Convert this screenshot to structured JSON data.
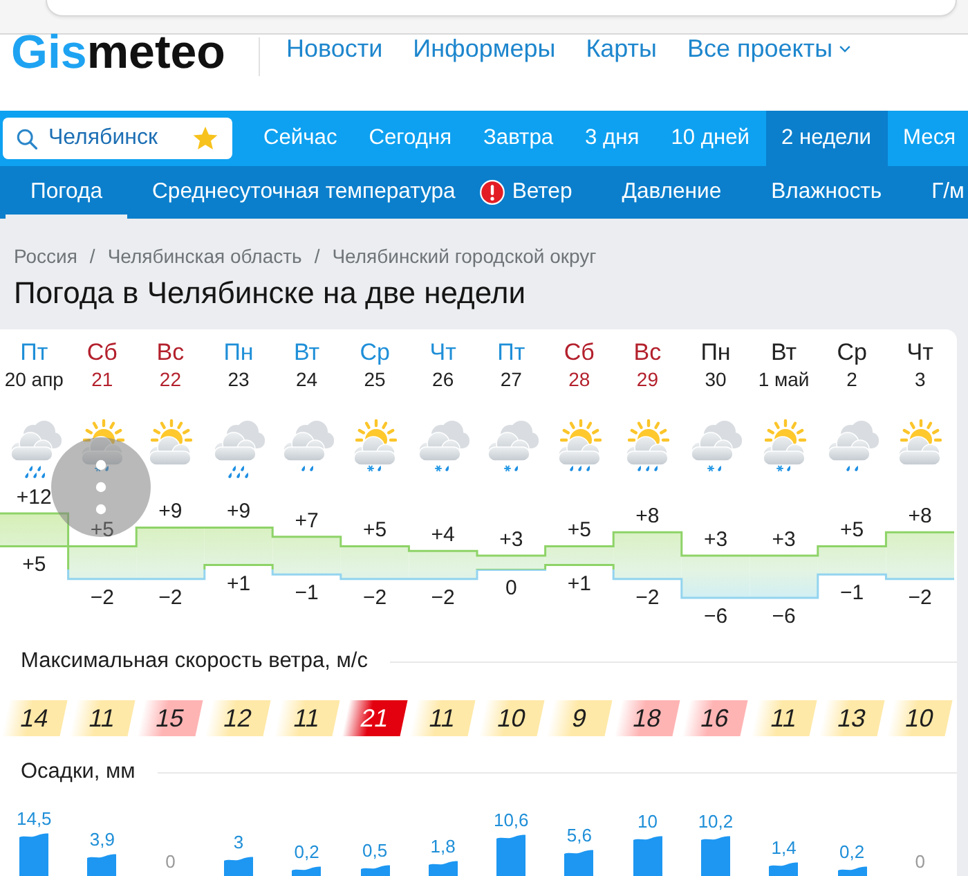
{
  "header": {
    "logo": {
      "accent": "Gis",
      "rest": "meteo"
    },
    "links": [
      {
        "label": "Новости",
        "dropdown": false
      },
      {
        "label": "Информеры",
        "dropdown": false
      },
      {
        "label": "Карты",
        "dropdown": false
      },
      {
        "label": "Все проекты",
        "dropdown": true
      }
    ]
  },
  "search": {
    "value": "Челябинск"
  },
  "periods": [
    {
      "label": "Сейчас",
      "selected": false
    },
    {
      "label": "Сегодня",
      "selected": false
    },
    {
      "label": "Завтра",
      "selected": false
    },
    {
      "label": "3 дня",
      "selected": false
    },
    {
      "label": "10 дней",
      "selected": false
    },
    {
      "label": "2 недели",
      "selected": true
    },
    {
      "label": "Меся",
      "selected": false
    }
  ],
  "sections": [
    {
      "label": "Погода",
      "selected": true,
      "alert": false
    },
    {
      "label": "Среднесуточная температура",
      "selected": false,
      "alert": false
    },
    {
      "label": "Ветер",
      "selected": false,
      "alert": true
    },
    {
      "label": "Давление",
      "selected": false,
      "alert": false
    },
    {
      "label": "Влажность",
      "selected": false,
      "alert": false
    },
    {
      "label": "Г/м",
      "selected": false,
      "alert": false
    }
  ],
  "breadcrumbs": [
    {
      "label": "Россия"
    },
    {
      "separator": "/",
      "label": "Челябинская область"
    },
    {
      "separator": "/",
      "label": "Челябинский городской округ"
    }
  ],
  "title": "Погода в Челябинске на две недели",
  "forecast": {
    "days": [
      {
        "name": "Пт",
        "date": "20 апр",
        "color": "#1f8fd8",
        "weekend": false,
        "kind": "heavyrain",
        "max": "+12",
        "min": "+5",
        "wind": {
          "speed": "14",
          "color": "#ffe9a8"
        },
        "precip": "14,5"
      },
      {
        "name": "Сб",
        "date": "21",
        "color": "#b3202c",
        "weekend": true,
        "kind": "partlysleet",
        "max": "+5",
        "min": "−2",
        "wind": {
          "speed": "11",
          "color": "#ffe9a8"
        },
        "precip": "3,9"
      },
      {
        "name": "Вс",
        "date": "22",
        "color": "#b3202c",
        "weekend": true,
        "kind": "partly",
        "max": "+9",
        "min": "−2",
        "wind": {
          "speed": "15",
          "color": "#ffb4b4"
        },
        "precip": "0"
      },
      {
        "name": "Пн",
        "date": "23",
        "color": "#1f8fd8",
        "weekend": false,
        "kind": "heavyrain",
        "max": "+9",
        "min": "+1",
        "wind": {
          "speed": "12",
          "color": "#ffe9a8"
        },
        "precip": "3"
      },
      {
        "name": "Вт",
        "date": "24",
        "color": "#1f8fd8",
        "weekend": false,
        "kind": "rain",
        "max": "+7",
        "min": "−1",
        "wind": {
          "speed": "11",
          "color": "#ffe9a8"
        },
        "precip": "0,2"
      },
      {
        "name": "Ср",
        "date": "25",
        "color": "#1f8fd8",
        "weekend": false,
        "kind": "partlysleet",
        "max": "+5",
        "min": "−2",
        "wind": {
          "speed": "21",
          "color": "#e3000f"
        },
        "precip": "0,5"
      },
      {
        "name": "Чт",
        "date": "26",
        "color": "#1f8fd8",
        "weekend": false,
        "kind": "sleet",
        "max": "+4",
        "min": "−2",
        "wind": {
          "speed": "11",
          "color": "#ffe9a8"
        },
        "precip": "1,8"
      },
      {
        "name": "Пт",
        "date": "27",
        "color": "#1f8fd8",
        "weekend": false,
        "kind": "sleet",
        "max": "+3",
        "min": "0",
        "wind": {
          "speed": "10",
          "color": "#ffe9a8"
        },
        "precip": "10,6"
      },
      {
        "name": "Сб",
        "date": "28",
        "color": "#b3202c",
        "weekend": true,
        "kind": "partlyheavyrain",
        "max": "+5",
        "min": "+1",
        "wind": {
          "speed": "9",
          "color": "#ffe9a8"
        },
        "precip": "5,6"
      },
      {
        "name": "Вс",
        "date": "29",
        "color": "#b3202c",
        "weekend": true,
        "kind": "partlyheavyrain",
        "max": "+8",
        "min": "−2",
        "wind": {
          "speed": "18",
          "color": "#ffb4b4"
        },
        "precip": "10"
      },
      {
        "name": "Пн",
        "date": "30",
        "color": "#222222",
        "weekend": false,
        "kind": "sleet",
        "max": "+3",
        "min": "−6",
        "wind": {
          "speed": "16",
          "color": "#ffb4b4"
        },
        "precip": "10,2"
      },
      {
        "name": "Вт",
        "date": "1 май",
        "color": "#222222",
        "weekend": false,
        "kind": "partlysleet",
        "max": "+3",
        "min": "−6",
        "wind": {
          "speed": "11",
          "color": "#ffe9a8"
        },
        "precip": "1,4"
      },
      {
        "name": "Ср",
        "date": "2",
        "color": "#222222",
        "weekend": false,
        "kind": "rain",
        "max": "+5",
        "min": "−1",
        "wind": {
          "speed": "13",
          "color": "#ffe9a8"
        },
        "precip": "0,2"
      },
      {
        "name": "Чт",
        "date": "3",
        "color": "#222222",
        "weekend": false,
        "kind": "partly",
        "max": "+8",
        "min": "−2",
        "wind": {
          "speed": "10",
          "color": "#ffe9a8"
        },
        "precip": "0"
      }
    ],
    "wind_title": "Максимальная скорость ветра, м/с",
    "precip_title": "Осадки, мм"
  }
}
